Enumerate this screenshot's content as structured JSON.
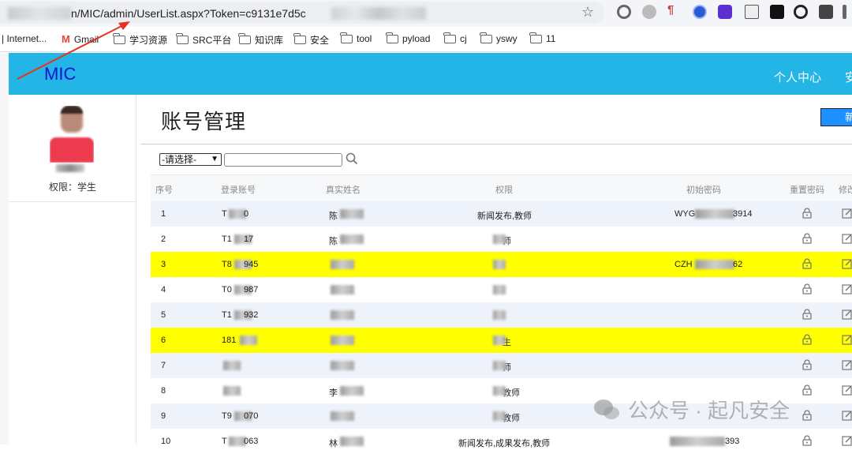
{
  "browser": {
    "url_visible": "n/MIC/admin/UserList.aspx?Token=c9131e7d5c",
    "bookmarks": [
      "| Internet...",
      "Gmail",
      "学习资源",
      "SRC平台",
      "知识库",
      "安全",
      "tool",
      "pyload",
      "cj",
      "yswy",
      "11"
    ]
  },
  "header": {
    "brand": "MIC",
    "nav": [
      "个人中心",
      "安"
    ]
  },
  "sidebar": {
    "role_label": "权限：学生"
  },
  "main": {
    "title": "账号管理",
    "add_button": "新",
    "filter": {
      "select_value": "-请选择-"
    },
    "columns": [
      "序号",
      "登录账号",
      "真实姓名",
      "权限",
      "初始密码",
      "重置密码",
      "修改"
    ],
    "rows": [
      {
        "no": "1",
        "account": "T",
        "account2": "0",
        "name": "陈",
        "perm": "新闻发布,教师",
        "pwd": "WYG",
        "pwd2": "3914"
      },
      {
        "no": "2",
        "account": "T1",
        "account2": "17",
        "name": "陈",
        "perm": "师",
        "pwd": "",
        "pwd2": ""
      },
      {
        "no": "3",
        "account": "T8",
        "account2": "945",
        "name": "",
        "perm": "",
        "pwd": "CZH",
        "pwd2": "62"
      },
      {
        "no": "4",
        "account": "T0",
        "account2": "987",
        "name": "",
        "perm": "",
        "pwd": "",
        "pwd2": ""
      },
      {
        "no": "5",
        "account": "T1",
        "account2": "932",
        "name": "",
        "perm": "",
        "pwd": "",
        "pwd2": ""
      },
      {
        "no": "6",
        "account": "181",
        "account2": "",
        "name": "",
        "perm": "生",
        "pwd": "",
        "pwd2": ""
      },
      {
        "no": "7",
        "account": "",
        "account2": "",
        "name": "",
        "perm": "师",
        "pwd": "",
        "pwd2": ""
      },
      {
        "no": "8",
        "account": "",
        "account2": "",
        "name": "李",
        "perm": "教师",
        "pwd": "",
        "pwd2": ""
      },
      {
        "no": "9",
        "account": "T9",
        "account2": "070",
        "name": "",
        "perm": "教师",
        "pwd": "",
        "pwd2": ""
      },
      {
        "no": "10",
        "account": "T",
        "account2": "063",
        "name": "林",
        "perm": "新闻发布,成果发布,教师",
        "pwd": "",
        "pwd2": "393"
      }
    ]
  },
  "watermark": {
    "text": "公众号 · 起凡安全"
  },
  "colors": {
    "header": "#22b5e6",
    "brand": "#1313d6",
    "highlight": "#ffff00",
    "alt_row": "#eef3fb",
    "arrow": "#e8321e"
  }
}
